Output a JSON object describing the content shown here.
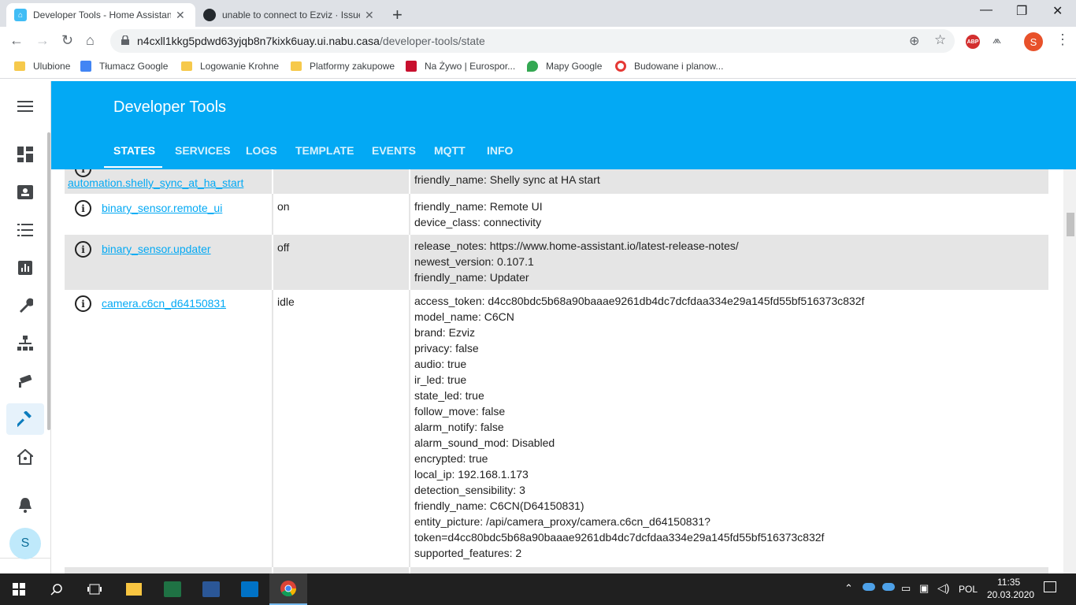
{
  "browser": {
    "tabs": [
      {
        "title": "Developer Tools - Home Assistant",
        "active": true
      },
      {
        "title": "unable to connect to Ezviz · Issue",
        "active": false
      }
    ],
    "url_host": "n4cxll1kkg5pdwd63yjqb8n7kixk6uay.ui.nabu.casa",
    "url_path": "/developer-tools/state",
    "profile_initial": "S",
    "bookmarks": [
      "Ulubione",
      "Tłumacz Google",
      "Logowanie Krohne",
      "Platformy zakupowe",
      "Na Żywo | Eurospor...",
      "Mapy Google",
      "Budowane i planow..."
    ],
    "ext_abp": "ABP"
  },
  "ha": {
    "title": "Developer Tools",
    "tabs": [
      "STATES",
      "SERVICES",
      "LOGS",
      "TEMPLATE",
      "EVENTS",
      "MQTT",
      "INFO"
    ],
    "active_tab": "STATES",
    "user_initial": "S",
    "sidebar_icons": [
      "menu-icon",
      "overview-icon",
      "map-icon",
      "logbook-icon",
      "history-icon",
      "configuration-icon",
      "hacs-icon",
      "camera-icon",
      "developer-tools-icon",
      "supervisor-icon",
      "notifications-icon"
    ]
  },
  "states": {
    "rows": [
      {
        "entity": "automation.shelly_sync_at_ha_start",
        "state": "",
        "attributes": [
          "friendly_name: Shelly sync at HA start"
        ]
      },
      {
        "entity": "binary_sensor.remote_ui",
        "state": "on",
        "attributes": [
          "friendly_name: Remote UI",
          "device_class: connectivity"
        ]
      },
      {
        "entity": "binary_sensor.updater",
        "state": "off",
        "attributes": [
          "release_notes: https://www.home-assistant.io/latest-release-notes/",
          "newest_version: 0.107.1",
          "friendly_name: Updater"
        ]
      },
      {
        "entity": "camera.c6cn_d64150831",
        "state": "idle",
        "attributes": [
          "access_token: d4cc80bdc5b68a90baaae9261db4dc7dcfdaa334e29a145fd55bf516373c832f",
          "model_name: C6CN",
          "brand: Ezviz",
          "privacy: false",
          "audio: true",
          "ir_led: true",
          "state_led: true",
          "follow_move: false",
          "alarm_notify: false",
          "alarm_sound_mod: Disabled",
          "encrypted: true",
          "local_ip: 192.168.1.173",
          "detection_sensibility: 3",
          "friendly_name: C6CN(D64150831)",
          "entity_picture: /api/camera_proxy/camera.c6cn_d64150831?",
          "token=d4cc80bdc5b68a90baaae9261db4dc7dcfdaa334e29a145fd55bf516373c832f",
          "supported_features: 2"
        ]
      }
    ]
  },
  "taskbar": {
    "language": "POL",
    "time": "11:35",
    "date": "20.03.2020"
  }
}
